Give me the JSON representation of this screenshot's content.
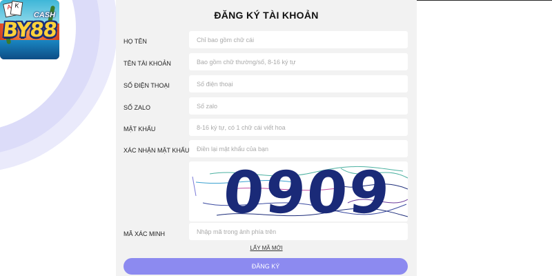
{
  "logo": {
    "brand_text": "BY88",
    "cash_text": "CASH"
  },
  "form": {
    "title": "ĐĂNG KÝ TÀI KHOẢN",
    "fields": [
      {
        "label": "HỌ TÊN",
        "placeholder": "Chỉ bao gồm chữ cái",
        "value": ""
      },
      {
        "label": "TÊN TÀI KHOẢN",
        "placeholder": "Bao gồm chữ thường/số, 8-16 ký tự",
        "value": ""
      },
      {
        "label": "SỐ ĐIỆN THOẠI",
        "placeholder": "Số điện thoại",
        "value": ""
      },
      {
        "label": "SỐ ZALO",
        "placeholder": "Số zalo",
        "value": ""
      },
      {
        "label": "MẬT KHẨU",
        "placeholder": "8-16 ký tự, có 1 chữ cái viết hoa",
        "value": ""
      },
      {
        "label": "XÁC NHẬN MẬT KHẨU",
        "placeholder": "Điền lại mật khẩu của bạn",
        "value": ""
      }
    ],
    "captcha": {
      "code": "0909",
      "label": "MÃ XÁC MINH",
      "placeholder": "Nhập mã trong ảnh phía trên",
      "value": "",
      "refresh_label": "LẤY MÃ MỚI"
    },
    "submit_label": "ĐĂNG KÝ"
  },
  "colors": {
    "accent": "#8c8af0",
    "panel_bg": "#f2f2f2",
    "captcha_text": "#1a2a78",
    "decor_light": "#e8e8fb",
    "decor_mid": "#d6d6f8"
  }
}
